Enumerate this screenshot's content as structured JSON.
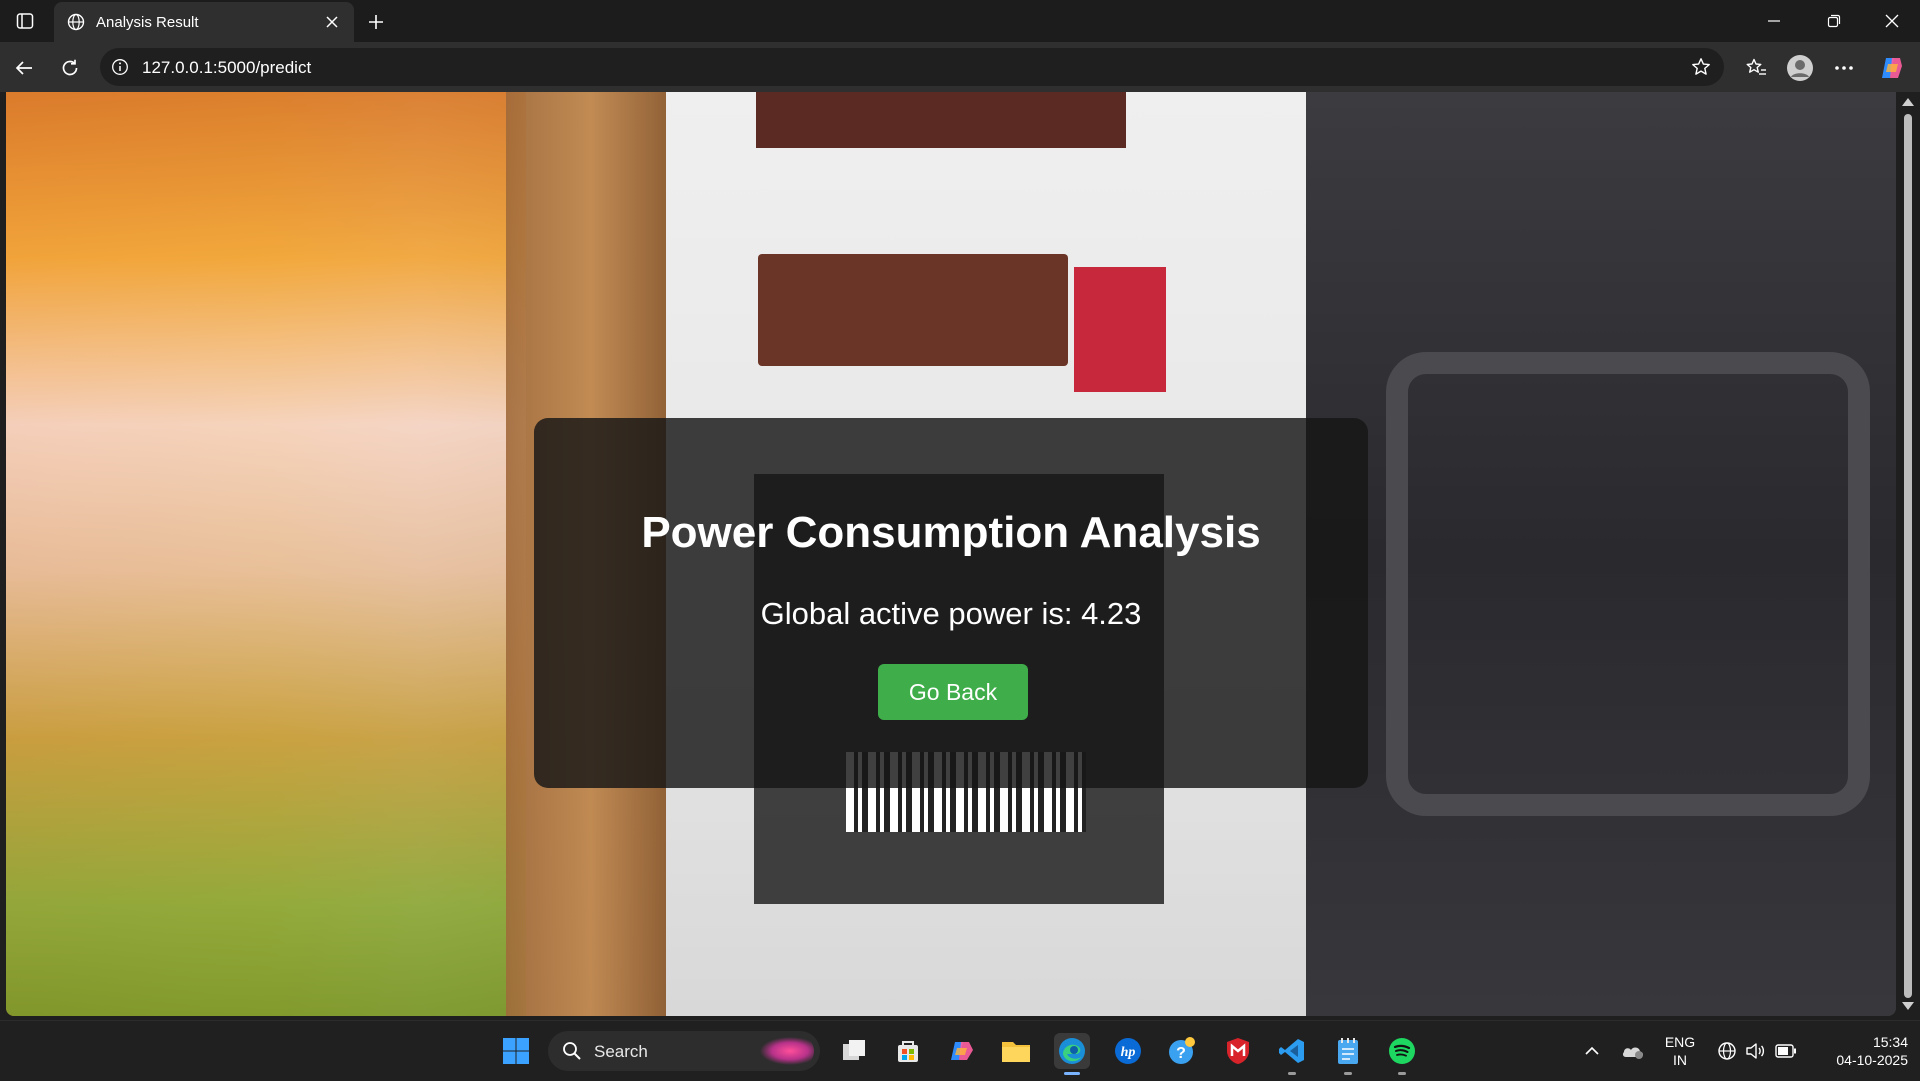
{
  "browser": {
    "tab_title": "Analysis Result",
    "url": "127.0.0.1:5000/predict"
  },
  "page": {
    "heading": "Power Consumption Analysis",
    "result_text": "Global active power is: 4.23",
    "go_back_label": "Go Back"
  },
  "taskbar": {
    "search_label": "Search",
    "language_line1": "ENG",
    "language_line2": "IN",
    "time": "15:34",
    "date": "04-10-2025"
  },
  "colors": {
    "button_green": "#3fae4a",
    "card_background": "#161616",
    "accent_blue": "#7ab3ff"
  }
}
